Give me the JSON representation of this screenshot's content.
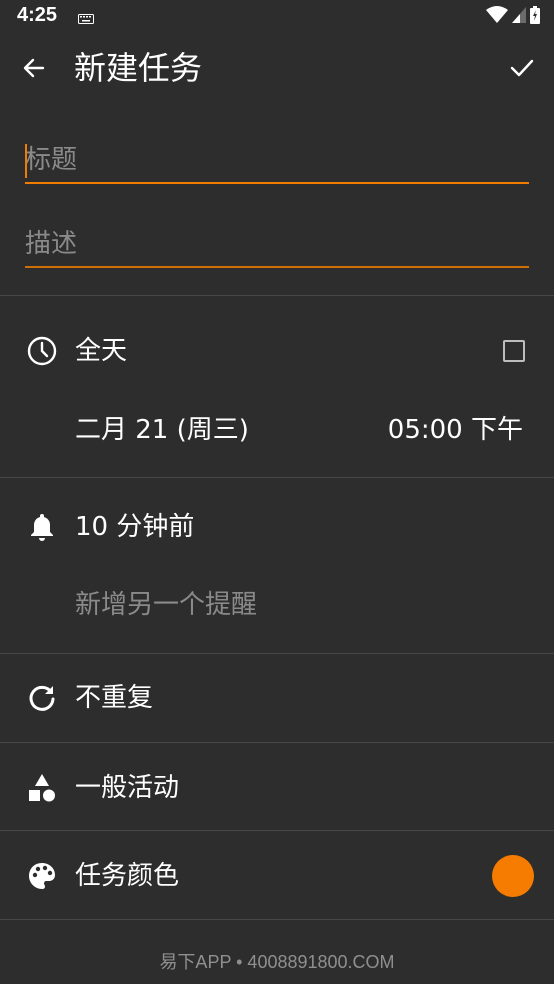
{
  "status_bar": {
    "time": "4:25",
    "icons": [
      "keyboard-icon",
      "wifi-icon",
      "signal-icon",
      "battery-icon"
    ]
  },
  "app_bar": {
    "title": "新建任务",
    "back_icon": "arrow-back-icon",
    "confirm_icon": "check-icon"
  },
  "form": {
    "title_placeholder": "标题",
    "title_value": "",
    "description_placeholder": "描述",
    "description_value": ""
  },
  "schedule": {
    "all_day_label": "全天",
    "all_day_checked": false,
    "date": "二月 21 (周三)",
    "time": "05:00 下午"
  },
  "reminders": {
    "current": "10 分钟前",
    "add_label": "新增另一个提醒"
  },
  "repeat": {
    "label": "不重复"
  },
  "category": {
    "label": "一般活动"
  },
  "task_color": {
    "label": "任务颜色",
    "color": "#f57c00"
  },
  "colors": {
    "background": "#2d2d2d",
    "accent": "#f07d00",
    "divider": "#474747",
    "muted_text": "#8a8a8a"
  },
  "watermark": {
    "text": "易下APP • 4008891800.COM"
  }
}
